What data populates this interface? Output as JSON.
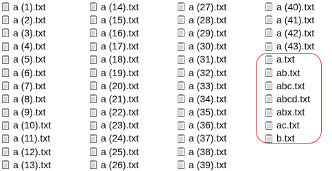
{
  "columns": [
    [
      "a (1).txt",
      "a (2).txt",
      "a (3).txt",
      "a (4).txt",
      "a (5).txt",
      "a (6).txt",
      "a (7).txt",
      "a (8).txt",
      "a (9).txt",
      "a (10).txt",
      "a (11).txt",
      "a (12).txt",
      "a (13).txt"
    ],
    [
      "a (14).txt",
      "a (15).txt",
      "a (16).txt",
      "a (17).txt",
      "a (18).txt",
      "a (19).txt",
      "a (20).txt",
      "a (21).txt",
      "a (22).txt",
      "a (23).txt",
      "a (24).txt",
      "a (25).txt",
      "a (26).txt"
    ],
    [
      "a (27).txt",
      "a (28).txt",
      "a (29).txt",
      "a (30).txt",
      "a (31).txt",
      "a (32).txt",
      "a (33).txt",
      "a (34).txt",
      "a (35).txt",
      "a (36).txt",
      "a (37).txt",
      "a (38).txt",
      "a (39).txt"
    ],
    [
      "a (40).txt",
      "a (41).txt",
      "a (42).txt",
      "a (43).txt",
      "a.txt",
      "ab.txt",
      "abc.txt",
      "abcd.txt",
      "abx.txt",
      "ac.txt",
      "b.txt"
    ]
  ],
  "icon": "text-document-icon",
  "highlight_color": "#e03030"
}
